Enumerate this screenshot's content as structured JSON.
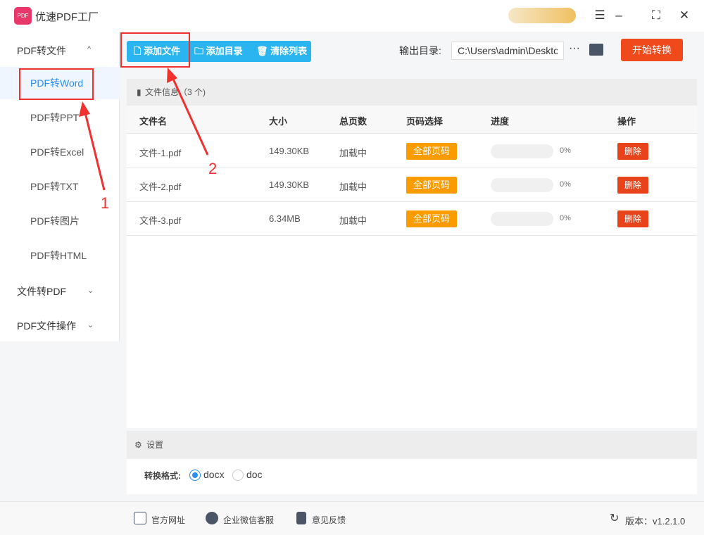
{
  "app": {
    "title": "优速PDF工厂",
    "logo_text": "PDF"
  },
  "window_controls": [
    "menu-icon",
    "minimize-icon",
    "maximize-icon",
    "close-icon"
  ],
  "sidebar": {
    "groups": [
      {
        "label": "PDF转文件",
        "expanded": true,
        "items": [
          {
            "label": "PDF转Word",
            "active": true
          },
          {
            "label": "PDF转PPT"
          },
          {
            "label": "PDF转Excel"
          },
          {
            "label": "PDF转TXT"
          },
          {
            "label": "PDF转图片"
          },
          {
            "label": "PDF转HTML"
          }
        ]
      },
      {
        "label": "文件转PDF",
        "expanded": false
      },
      {
        "label": "PDF文件操作",
        "expanded": false
      }
    ]
  },
  "toolbar": {
    "add_file": "添加文件",
    "add_folder": "添加目录",
    "clear_list": "清除列表",
    "output_label": "输出目录:",
    "output_path": "C:\\Users\\admin\\Desktop",
    "more": "···",
    "start": "开始转换"
  },
  "file_panel": {
    "title": "文件信息（3 个)",
    "columns": [
      "文件名",
      "大小",
      "总页数",
      "页码选择",
      "进度",
      "操作"
    ],
    "rows": [
      {
        "name": "文件-1.pdf",
        "size": "149.30KB",
        "pages": "加载中",
        "page_select": "全部页码",
        "progress": "0%",
        "action": "删除"
      },
      {
        "name": "文件-2.pdf",
        "size": "149.30KB",
        "pages": "加载中",
        "page_select": "全部页码",
        "progress": "0%",
        "action": "删除"
      },
      {
        "name": "文件-3.pdf",
        "size": "6.34MB",
        "pages": "加载中",
        "page_select": "全部页码",
        "progress": "0%",
        "action": "删除"
      }
    ]
  },
  "settings": {
    "title": "设置",
    "format_label": "转换格式:",
    "options": [
      {
        "label": "docx",
        "selected": true
      },
      {
        "label": "doc",
        "selected": false
      }
    ]
  },
  "footer": {
    "website": "官方网址",
    "wechat": "企业微信客服",
    "feedback": "意见反馈",
    "version": "版本：v1.2.1.0"
  },
  "annotations": {
    "step1": "1",
    "step2": "2",
    "color": "#f23030"
  },
  "colors": {
    "accent": "#2b8ef0",
    "toolbar": "#2ab5f0",
    "start": "#f04a1c",
    "page_btn": "#fa9b00",
    "delete": "#e8441b"
  }
}
